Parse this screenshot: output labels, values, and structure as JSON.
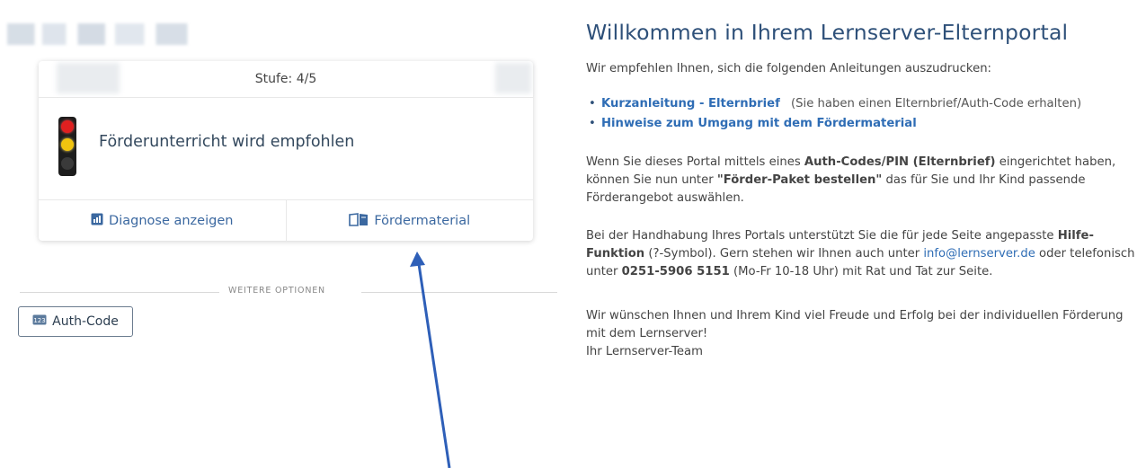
{
  "card": {
    "level": "Stufe: 4/5",
    "recommendation": "Förderunterricht wird empfohlen",
    "diagnose_label": "Diagnose anzeigen",
    "material_label": "Fördermaterial"
  },
  "options": {
    "divider": "WEITERE OPTIONEN",
    "auth_label": "Auth-Code"
  },
  "welcome": {
    "title": "Willkommen in Ihrem Lernserver-Elternportal",
    "intro": "Wir empfehlen Ihnen, sich die folgenden Anleitungen auszudrucken:",
    "links": [
      {
        "label": "Kurzanleitung - Elternbrief",
        "note": "(Sie haben einen Elternbrief/Auth-Code erhalten)"
      },
      {
        "label": "Hinweise zum Umgang mit dem Fördermaterial",
        "note": ""
      }
    ],
    "p2_a": "Wenn Sie dieses Portal mittels eines ",
    "p2_b": "Auth-Codes/PIN (Elternbrief)",
    "p2_c": " eingerichtet haben, können Sie nun unter ",
    "p2_d": "\"Förder-Paket bestellen\"",
    "p2_e": " das für Sie und Ihr Kind passende Förderangebot auswählen.",
    "p3_a": "Bei der Handhabung Ihres Portals unterstützt Sie die für jede Seite  angepasste ",
    "p3_b": "Hilfe-Funktion",
    "p3_c": " (?-Symbol). Gern stehen wir Ihnen auch unter ",
    "p3_email": "info@lernserver.de",
    "p3_d": " oder telefonisch unter ",
    "p3_phone": "0251-5906 5151",
    "p3_e": " (Mo-Fr 10-18 Uhr) mit Rat und Tat zur Seite.",
    "p4_a": "Wir wünschen Ihnen und Ihrem Kind viel Freude und Erfolg bei der individuellen Förderung mit dem Lernserver!",
    "p4_b": " Ihr Lernserver-Team"
  },
  "icons": [
    "traffic-light-icon",
    "bar-chart-icon",
    "book-icon",
    "keypad-icon"
  ],
  "colors": {
    "link": "#2f6db5",
    "title": "#2e5079",
    "arrow": "#3a66c4"
  }
}
